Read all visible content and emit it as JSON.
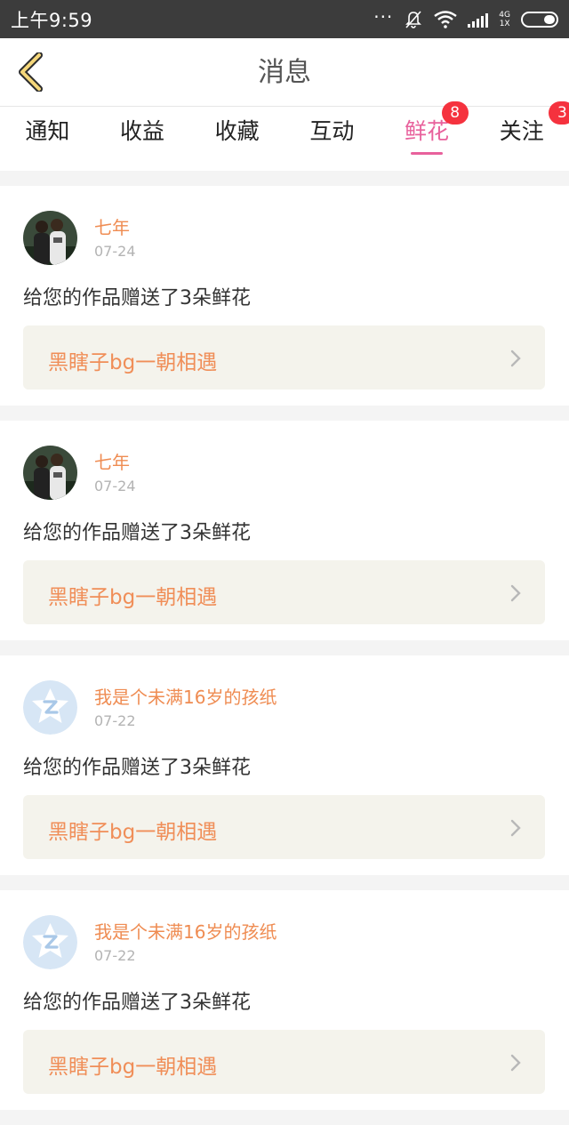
{
  "status_bar": {
    "time": "上午9:59",
    "more_icon": "···",
    "net_top": "4G",
    "net_bottom": "1X"
  },
  "header": {
    "title": "消息",
    "back_icon": "chevron-left-icon"
  },
  "tabs": [
    {
      "label": "通知",
      "badge": ""
    },
    {
      "label": "收益",
      "badge": ""
    },
    {
      "label": "收藏",
      "badge": ""
    },
    {
      "label": "互动",
      "badge": ""
    },
    {
      "label": "鲜花",
      "badge": "8",
      "active": true
    },
    {
      "label": "关注",
      "badge": "3"
    }
  ],
  "messages": [
    {
      "user": "七年",
      "date": "07-24",
      "text": "给您的作品赠送了3朵鲜花",
      "work": "黑瞎子bg一朝相遇",
      "avatar": "photo"
    },
    {
      "user": "七年",
      "date": "07-24",
      "text": "给您的作品赠送了3朵鲜花",
      "work": "黑瞎子bg一朝相遇",
      "avatar": "photo"
    },
    {
      "user": "我是个未满16岁的孩纸",
      "date": "07-22",
      "text": "给您的作品赠送了3朵鲜花",
      "work": "黑瞎子bg一朝相遇",
      "avatar": "qq-default"
    },
    {
      "user": "我是个未满16岁的孩纸",
      "date": "07-22",
      "text": "给您的作品赠送了3朵鲜花",
      "work": "黑瞎子bg一朝相遇",
      "avatar": "qq-default"
    }
  ],
  "colors": {
    "accent_pink": "#e8619c",
    "name_orange": "#ef8c52",
    "badge_red": "#f5323e",
    "link_bg": "#f4f3ec"
  }
}
